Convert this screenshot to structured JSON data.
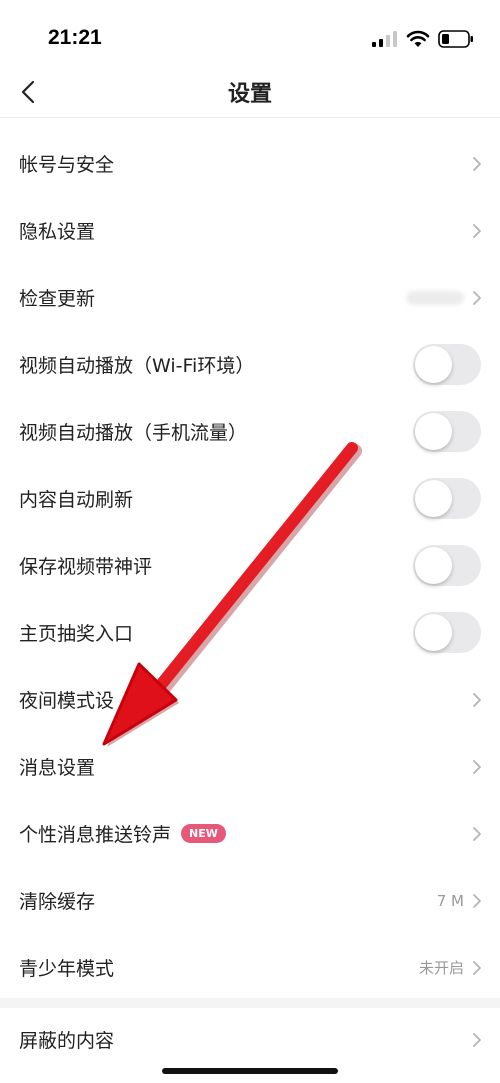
{
  "status_bar": {
    "time": "21:21"
  },
  "header": {
    "title": "设置"
  },
  "settings": {
    "account_security": "帐号与安全",
    "privacy": "隐私设置",
    "check_update": "检查更新",
    "video_autoplay_wifi": "视频自动播放（Wi-Fi环境）",
    "video_autoplay_mobile": "视频自动播放（手机流量）",
    "auto_refresh": "内容自动刷新",
    "save_video_comment": "保存视频带神评",
    "lottery_entry": "主页抽奖入口",
    "night_mode": "夜间模式设",
    "message_settings": "消息设置",
    "push_ringtone": "个性消息推送铃声",
    "push_ringtone_badge": "NEW",
    "clear_cache": "清除缓存",
    "cache_size": "7 M",
    "youth_mode": "青少年模式",
    "youth_mode_status": "未开启",
    "blocked_content": "屏蔽的内容"
  },
  "toggles": {
    "video_autoplay_wifi": false,
    "video_autoplay_mobile": false,
    "auto_refresh": false,
    "save_video_comment": false,
    "lottery_entry": false
  },
  "colors": {
    "annotation_arrow": "#e0101a",
    "badge": "#e7577a",
    "toggle_off": "#e9e9eb"
  }
}
